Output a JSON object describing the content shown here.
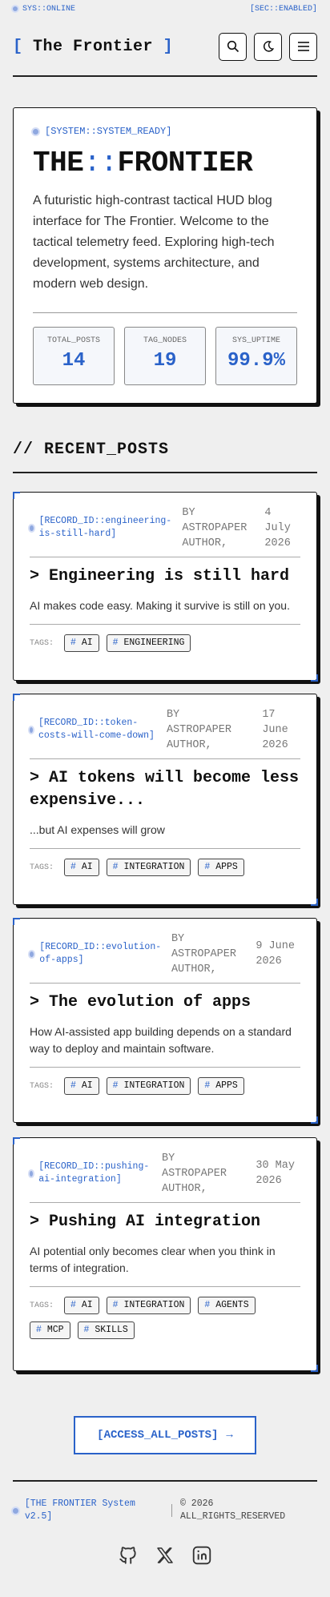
{
  "status": {
    "left": "SYS::ONLINE",
    "right": "[SEC::ENABLED]"
  },
  "header": {
    "bracket_open": "[",
    "title": "The Frontier",
    "bracket_close": "]"
  },
  "hero": {
    "system_tag": "[SYSTEM::SYSTEM_READY]",
    "title_a": "THE",
    "title_sep": "::",
    "title_b": "FRONTIER",
    "description": "A futuristic high-contrast tactical HUD blog interface for The Frontier. Welcome to the tactical telemetry feed. Exploring high-tech development, systems architecture, and modern web design.",
    "stats": [
      {
        "label": "TOTAL_POSTS",
        "value": "14"
      },
      {
        "label": "TAG_NODES",
        "value": "19"
      },
      {
        "label": "SYS_UPTIME",
        "value": "99.9%"
      }
    ]
  },
  "recent": {
    "title": "// RECENT_POSTS"
  },
  "posts": [
    {
      "record_id": "[RECORD_ID::engineering-is-still-hard]",
      "author": "BY ASTROPAPER AUTHOR,",
      "date": "4 July 2026",
      "title": "> Engineering is still hard",
      "description": "AI makes code easy. Making it survive is still on you.",
      "tags_label": "TAGS:",
      "tags": [
        "AI",
        "ENGINEERING"
      ]
    },
    {
      "record_id": "[RECORD_ID::token-costs-will-come-down]",
      "author": "BY ASTROPAPER AUTHOR,",
      "date": "17 June 2026",
      "title": "> AI tokens will become less expensive...",
      "description": "...but AI expenses will grow",
      "tags_label": "TAGS:",
      "tags": [
        "AI",
        "INTEGRATION",
        "APPS"
      ]
    },
    {
      "record_id": "[RECORD_ID::evolution-of-apps]",
      "author": "BY ASTROPAPER AUTHOR,",
      "date": "9 June 2026",
      "title": "> The evolution of apps",
      "description": "How AI-assisted app building depends on a standard way to deploy and maintain software.",
      "tags_label": "TAGS:",
      "tags": [
        "AI",
        "INTEGRATION",
        "APPS"
      ]
    },
    {
      "record_id": "[RECORD_ID::pushing-ai-integration]",
      "author": "BY ASTROPAPER AUTHOR,",
      "date": "30 May 2026",
      "title": "> Pushing AI integration",
      "description": "AI potential only becomes clear when you think in terms of integration.",
      "tags_label": "TAGS:",
      "tags": [
        "AI",
        "INTEGRATION",
        "AGENTS",
        "MCP",
        "SKILLS"
      ]
    }
  ],
  "tag_prefix": "#",
  "access": {
    "label": "[ACCESS_ALL_POSTS]",
    "arrow": "→"
  },
  "footer": {
    "system": "[THE FRONTIER System v2.5]",
    "copyright": "© 2026 ALL_RIGHTS_RESERVED"
  },
  "icons": {
    "search": "search-icon",
    "theme": "moon-icon",
    "menu": "menu-icon",
    "github": "github-icon",
    "x": "x-icon",
    "linkedin": "linkedin-icon"
  },
  "colors": {
    "accent": "#2a62c9",
    "ink": "#111111",
    "background": "#efefef"
  }
}
